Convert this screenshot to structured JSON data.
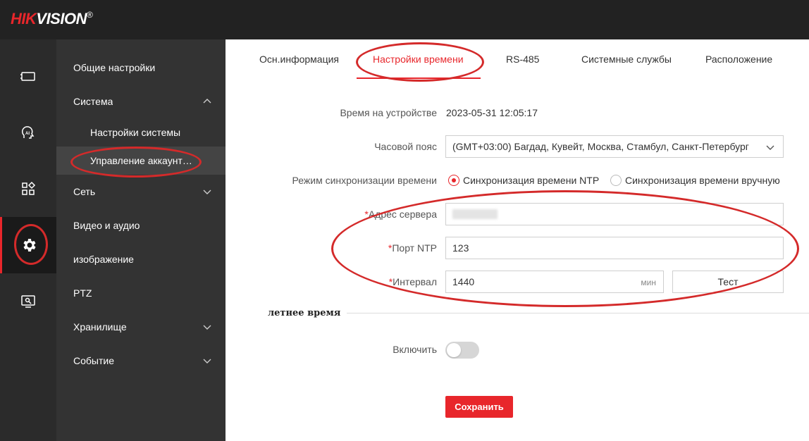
{
  "brand": {
    "hik": "HIK",
    "vision": "VISION",
    "reg": "®"
  },
  "rail": {
    "items": [
      {
        "icon": "camera-icon"
      },
      {
        "icon": "ai-head-icon"
      },
      {
        "icon": "apps-grid-icon"
      },
      {
        "icon": "gear-icon",
        "active": true
      },
      {
        "icon": "monitor-settings-icon"
      }
    ]
  },
  "menu": {
    "general": "Общие настройки",
    "system": "Система",
    "system_settings": "Настройки системы",
    "account_management": "Управление аккаунт…",
    "network": "Сеть",
    "video_audio": "Видео и аудио",
    "image": "изображение",
    "ptz": "PTZ",
    "storage": "Хранилище",
    "event": "Событие"
  },
  "tabs": {
    "basic_info": "Осн.информация",
    "time_settings": "Настройки времени",
    "rs485": "RS-485",
    "system_services": "Системные службы",
    "location": "Расположение"
  },
  "form": {
    "device_time_label": "Время на устройстве",
    "device_time_value": "2023-05-31 12:05:17",
    "timezone_label": "Часовой пояс",
    "timezone_value": "(GMT+03:00) Багдад, Кувейт, Москва, Стамбул, Санкт-Петербург",
    "sync_mode_label": "Режим синхронизации времени",
    "sync_ntp": "Синхронизация времени NTP",
    "sync_manual": "Синхронизация времени вручную",
    "required_mark": "*",
    "server_address_label": "Адрес сервера",
    "ntp_port_label": "Порт NTP",
    "ntp_port_value": "123",
    "interval_label": "Интервал",
    "interval_value": "1440",
    "interval_unit": "мин",
    "test_button": "Тест"
  },
  "dst": {
    "title": "летнее время",
    "enable_label": "Включить",
    "enabled": false
  },
  "save_button": "Сохранить",
  "colors": {
    "accent": "#e8262b",
    "topbar": "#222222",
    "menu": "#333333",
    "rail": "#2b2b2b"
  }
}
